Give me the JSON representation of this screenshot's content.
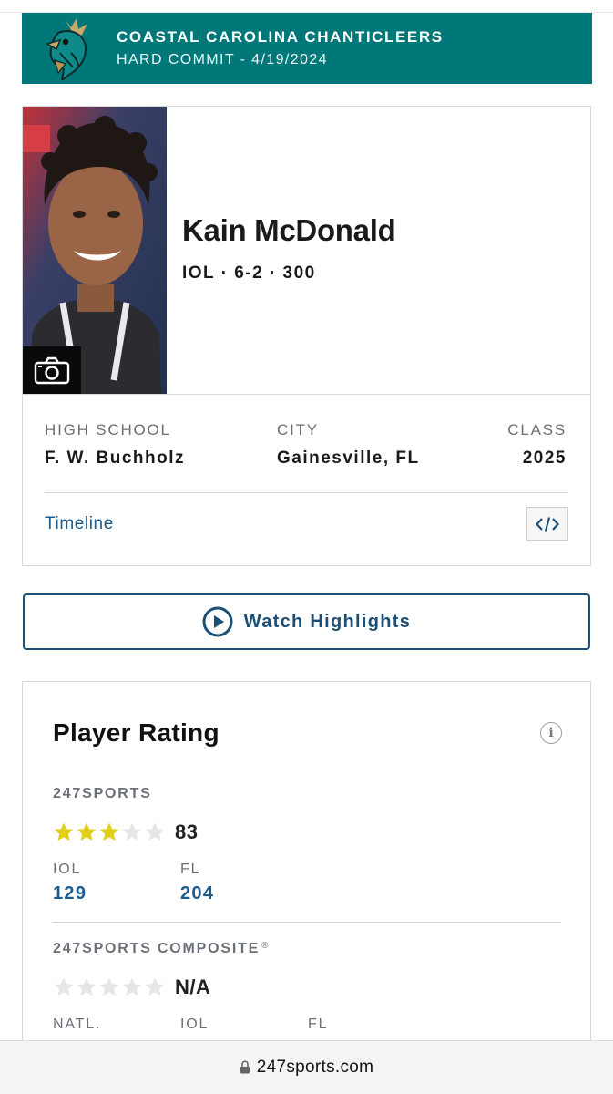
{
  "banner": {
    "team": "COASTAL CAROLINA CHANTICLEERS",
    "status": "HARD COMMIT - 4/19/2024",
    "logo_icon": "chanticleer-logo-icon",
    "color": "#00787a"
  },
  "player": {
    "name": "Kain McDonald",
    "info": "IOL · 6-2 · 300",
    "photo_icon": "camera-icon",
    "high_school_label": "HIGH SCHOOL",
    "high_school": "F. W. Buchholz",
    "city_label": "CITY",
    "city": "Gainesville, FL",
    "class_label": "CLASS",
    "class": "2025",
    "timeline_label": "Timeline",
    "embed_icon": "code-embed-icon"
  },
  "highlights": {
    "label": "Watch Highlights",
    "icon": "play-circle-icon"
  },
  "rating": {
    "title": "Player Rating",
    "info_glyph": "i",
    "s247": {
      "label": "247SPORTS",
      "stars": 3,
      "max_stars": 5,
      "score": "83",
      "ranks": [
        {
          "label": "IOL",
          "value": "129"
        },
        {
          "label": "FL",
          "value": "204"
        }
      ]
    },
    "composite": {
      "label": "247SPORTS COMPOSITE",
      "reg": "®",
      "stars": 0,
      "max_stars": 5,
      "score": "N/A",
      "rank_labels": [
        "NATL.",
        "IOL",
        "FL"
      ]
    },
    "star_color": "#e3cf1a",
    "empty_star_color": "#e6e6e6"
  },
  "browser": {
    "url": "247sports.com",
    "lock_icon": "lock-icon"
  }
}
